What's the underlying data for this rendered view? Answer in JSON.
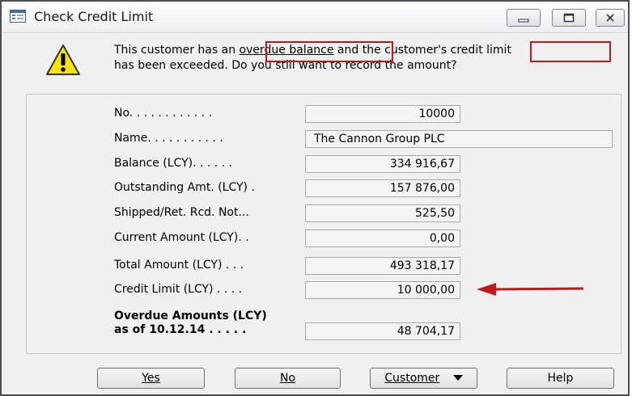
{
  "window": {
    "title": "Check Credit Limit"
  },
  "message": {
    "line1_a": "This customer has an ",
    "line1_b": "overdue balance",
    "line1_c": " and the customer's ",
    "line1_d": "credit limit",
    "line2": "has been exceeded. Do you still want to record the amount?"
  },
  "fields": [
    {
      "label": "No. . . . . . . . . . . .",
      "value": "10000"
    },
    {
      "label": "Name. . . . . . . . . . .",
      "value": "The Cannon Group PLC"
    },
    {
      "label": "Balance (LCY). . . . . .",
      "value": "334 916,67"
    },
    {
      "label": "Outstanding Amt. (LCY) .",
      "value": "157 876,00"
    },
    {
      "label": "Shipped/Ret. Rcd. Not...",
      "value": "525,50"
    },
    {
      "label": "Current Amount (LCY). .",
      "value": "0,00"
    },
    {
      "label": "Total Amount (LCY) . . .",
      "value": "493 318,17"
    },
    {
      "label": "Credit Limit (LCY) . . . .",
      "value": "10 000,00"
    }
  ],
  "overdue": {
    "label_line1": "Overdue Amounts (LCY)",
    "label_line2": "as of 10.12.14 . . . . .",
    "value": "48 704,17"
  },
  "buttons": {
    "yes": "Yes",
    "no": "No",
    "customer": "Customer",
    "help": "Help"
  },
  "colors": {
    "highlight": "#c0191c"
  },
  "icons": [
    "window-icon",
    "warning-icon",
    "minimize-icon",
    "maximize-icon",
    "close-icon",
    "dropdown-arrow-icon",
    "red-arrow-icon"
  ]
}
